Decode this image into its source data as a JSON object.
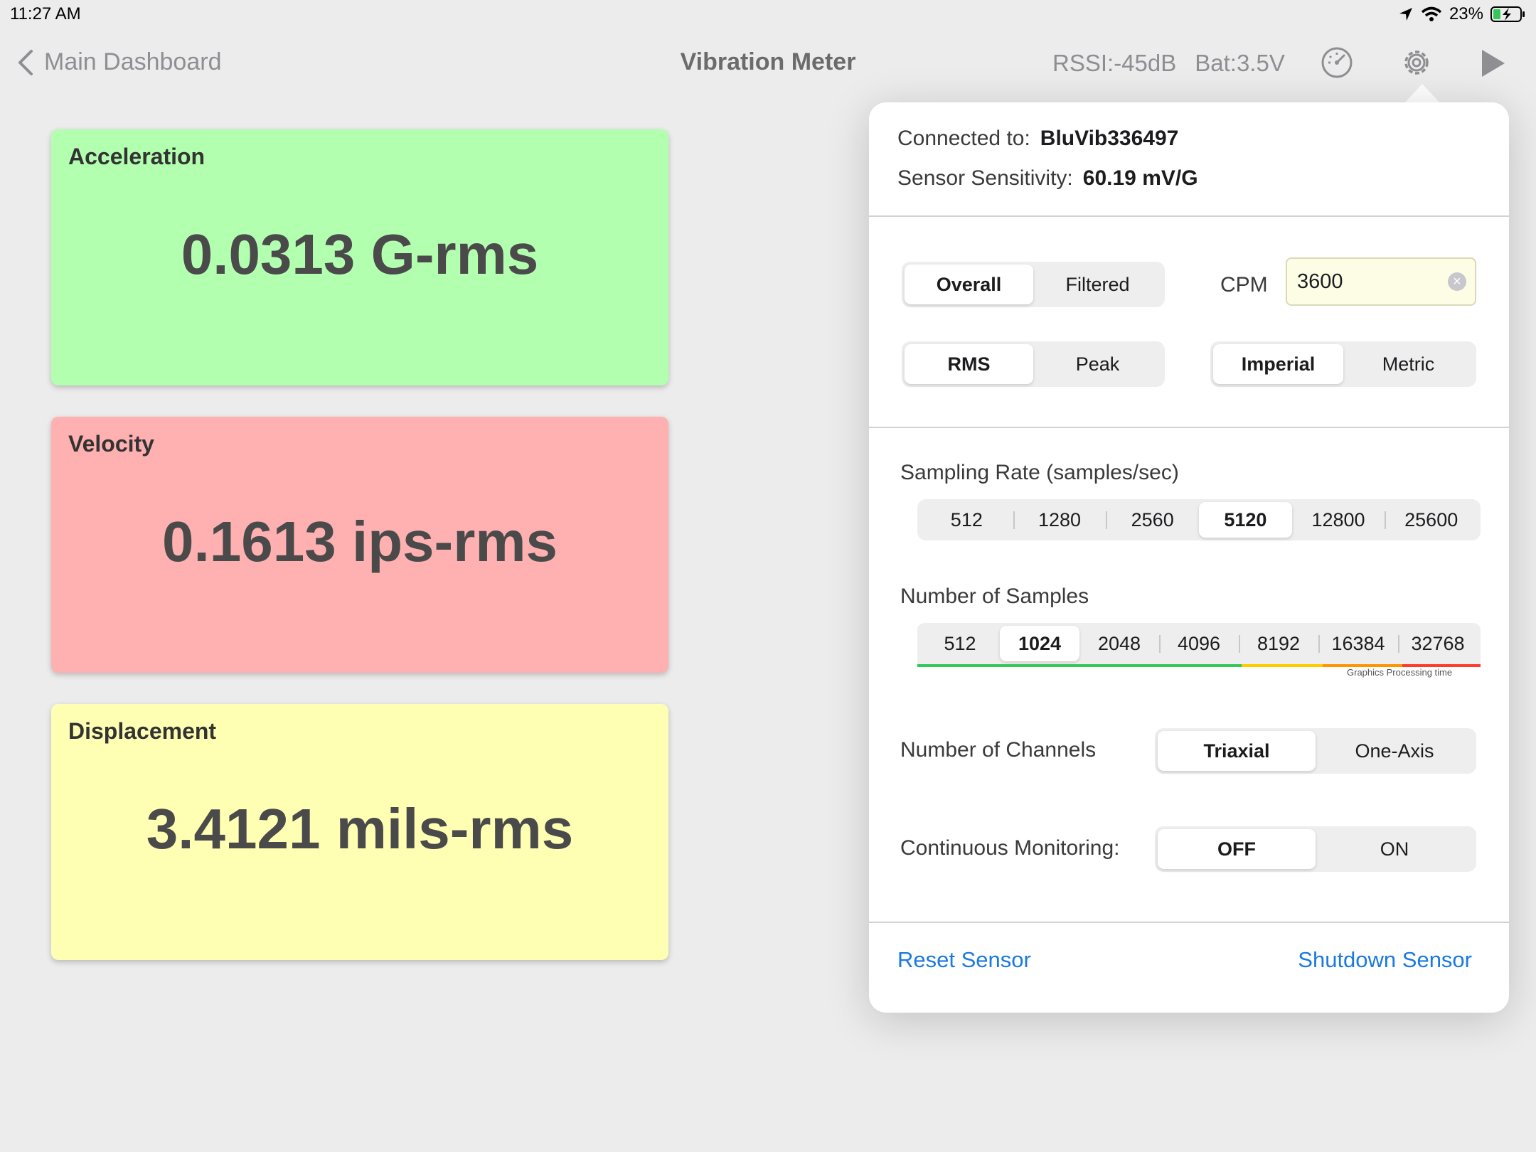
{
  "status_bar": {
    "time": "11:27 AM",
    "battery_percent": "23%",
    "icons": [
      "location-arrow-icon",
      "wifi-icon",
      "battery-charging-icon"
    ]
  },
  "nav": {
    "back_label": "Main Dashboard",
    "title": "Vibration Meter",
    "rssi": "RSSI:-45dB",
    "battery": "Bat:3.5V",
    "icons": [
      "back-chevron-icon",
      "gauge-icon",
      "gear-icon",
      "play-icon"
    ]
  },
  "cards": {
    "acceleration": {
      "label": "Acceleration",
      "value": "0.0313 G-rms",
      "color": "#b3ffb0"
    },
    "velocity": {
      "label": "Velocity",
      "value": "0.1613 ips-rms",
      "color": "#ffb0b0"
    },
    "displacement": {
      "label": "Displacement",
      "value": "3.4121 mils-rms",
      "color": "#ffffb3"
    }
  },
  "popover": {
    "connected_label": "Connected to:",
    "connected_value": "BluVib336497",
    "sensitivity_label": "Sensor Sensitivity:",
    "sensitivity_value": "60.19 mV/G",
    "mode": {
      "options": [
        "Overall",
        "Filtered"
      ],
      "selected": "Overall"
    },
    "cpm": {
      "label": "CPM",
      "value": "3600"
    },
    "amplitude": {
      "options": [
        "RMS",
        "Peak"
      ],
      "selected": "RMS"
    },
    "units": {
      "options": [
        "Imperial",
        "Metric"
      ],
      "selected": "Imperial"
    },
    "sampling_rate": {
      "label": "Sampling Rate (samples/sec)",
      "options": [
        "512",
        "1280",
        "2560",
        "5120",
        "12800",
        "25600"
      ],
      "selected": "5120"
    },
    "num_samples": {
      "label": "Number of Samples",
      "options": [
        "512",
        "1024",
        "2048",
        "4096",
        "8192",
        "16384",
        "32768"
      ],
      "selected": "1024",
      "note": "Graphics Processing time",
      "bar_colors": [
        "#34c759",
        "#ffcc00",
        "#ff9500",
        "#ff3b30"
      ]
    },
    "channels": {
      "label": "Number of Channels",
      "options": [
        "Triaxial",
        "One-Axis"
      ],
      "selected": "Triaxial"
    },
    "monitoring": {
      "label": "Continuous Monitoring:",
      "options": [
        "OFF",
        "ON"
      ],
      "selected": "OFF"
    },
    "reset_label": "Reset Sensor",
    "shutdown_label": "Shutdown Sensor",
    "link_color": "#1a7ae0"
  }
}
